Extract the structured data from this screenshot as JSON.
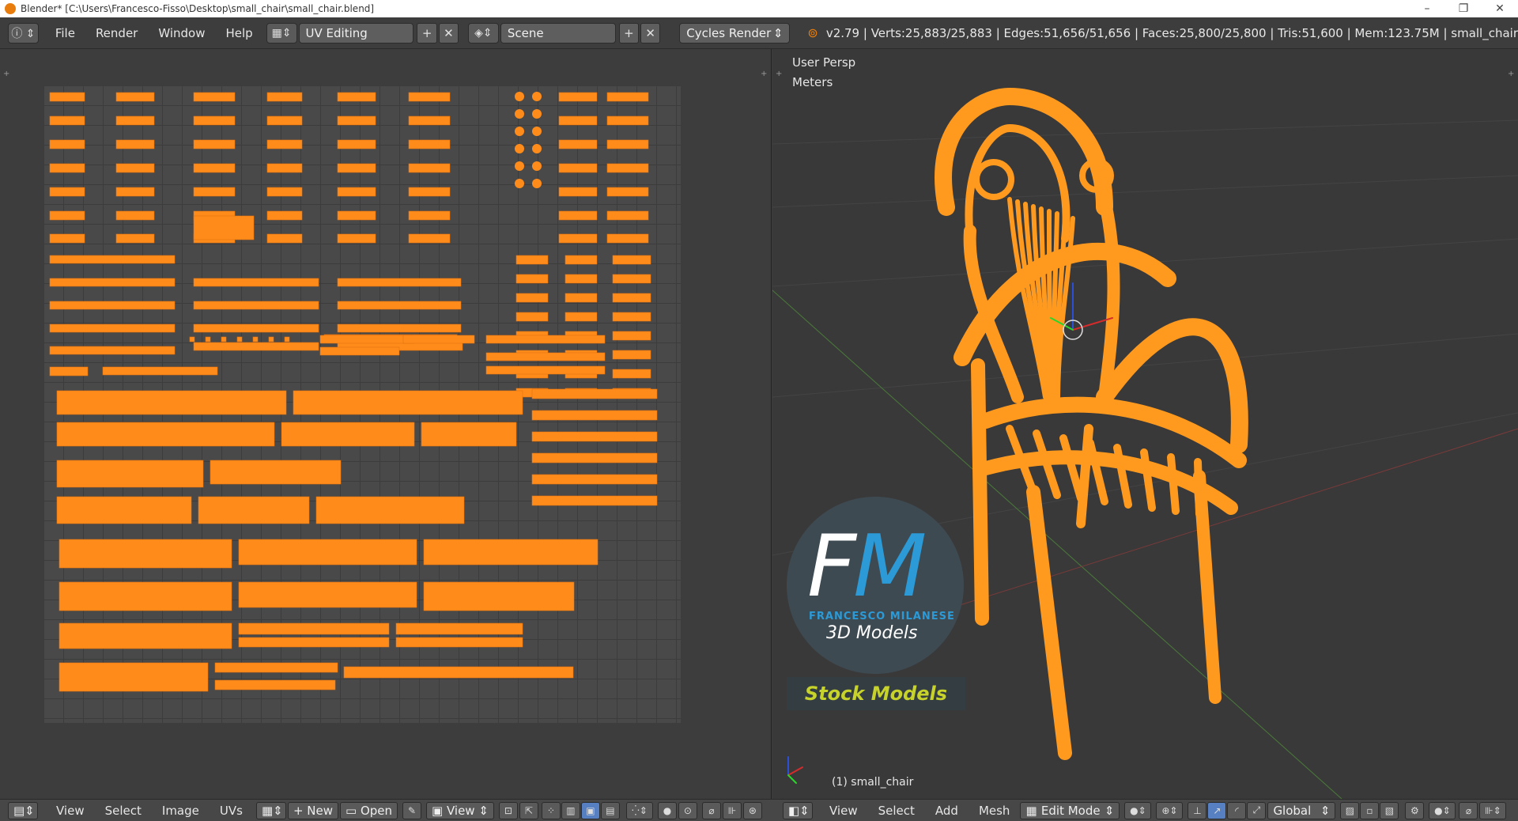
{
  "window": {
    "title": "Blender* [C:\\Users\\Francesco-Fisso\\Desktop\\small_chair\\small_chair.blend]",
    "controls": [
      "–",
      "❐",
      "✕"
    ]
  },
  "info_header": {
    "menus": [
      "File",
      "Render",
      "Window",
      "Help"
    ],
    "screen_layout": "UV Editing",
    "scene": "Scene",
    "render_engine": "Cycles Render",
    "stats": "v2.79 | Verts:25,883/25,883 | Edges:51,656/51,656 | Faces:25,800/25,800 | Tris:51,600 | Mem:123.75M | small_chair"
  },
  "viewport": {
    "view_name": "User Persp",
    "units": "Meters",
    "object_label": "(1) small_chair"
  },
  "watermark": {
    "f": "F",
    "m": "M",
    "name": "FRANCESCO MILANESE",
    "subtitle": "3D Models",
    "stock": "Stock Models"
  },
  "uv_footer": {
    "menus": [
      "View",
      "Select",
      "Image",
      "UVs"
    ],
    "new_label": "New",
    "open_label": "Open",
    "view_label": "View"
  },
  "view3d_footer": {
    "menus": [
      "View",
      "Select",
      "Add",
      "Mesh"
    ],
    "mode": "Edit Mode",
    "orientation": "Global"
  },
  "colors": {
    "uv_island": "#ff8c1a",
    "mesh_wire": "#ff9a1f",
    "mesh_fill": "#c98a3e",
    "grid_bg": "#494949",
    "accent_blue": "#5680c2"
  }
}
